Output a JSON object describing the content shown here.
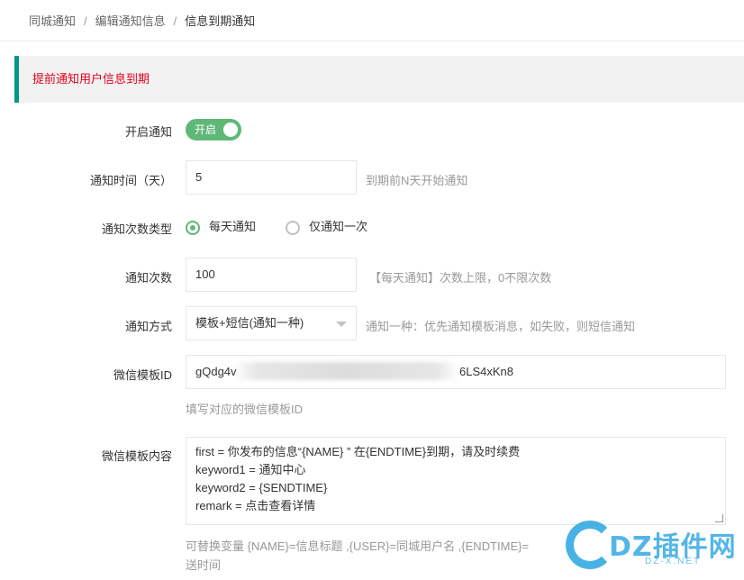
{
  "breadcrumb": {
    "items": [
      "同城通知",
      "编辑通知信息"
    ],
    "current": "信息到期通知",
    "separator": "/"
  },
  "notice": "提前通知用户信息到期",
  "form": {
    "enable": {
      "label": "开启通知",
      "switch_text": "开启",
      "on": true
    },
    "days": {
      "label": "通知时间（天）",
      "value": "5",
      "help": "到期前N天开始通知"
    },
    "count_type": {
      "label": "通知次数类型",
      "options": [
        "每天通知",
        "仅通知一次"
      ],
      "selected": 0
    },
    "count": {
      "label": "通知次数",
      "value": "100",
      "help": "【每天通知】次数上限，0不限次数"
    },
    "method": {
      "label": "通知方式",
      "value": "模板+短信(通知一种)",
      "help": "通知一种：优先通知模板消息，如失败，则短信通知"
    },
    "template_id": {
      "label": "微信模板ID",
      "value_start": "gQdg4v",
      "value_end": "6LS4xKn8",
      "help": "填写对应的微信模板ID"
    },
    "template_content": {
      "label": "微信模板内容",
      "lines": [
        "first = 你发布的信息“{NAME} ” 在{ENDTIME}到期，请及时续费",
        "keyword1 =  通知中心",
        "keyword2 = {SENDTIME}",
        "remark = 点击查看详情"
      ],
      "help_line1": "可替换变量  {NAME}=信息标题  ,{USER}=同城用户名  ,{ENDTIME}=",
      "help_line2": "送时间"
    }
  },
  "watermark": {
    "text": "DZ插件网",
    "sub": "DZ-X.NET"
  },
  "colors": {
    "accent": "#5fb878",
    "notice_border": "#009688",
    "notice_text": "#e0001a"
  }
}
